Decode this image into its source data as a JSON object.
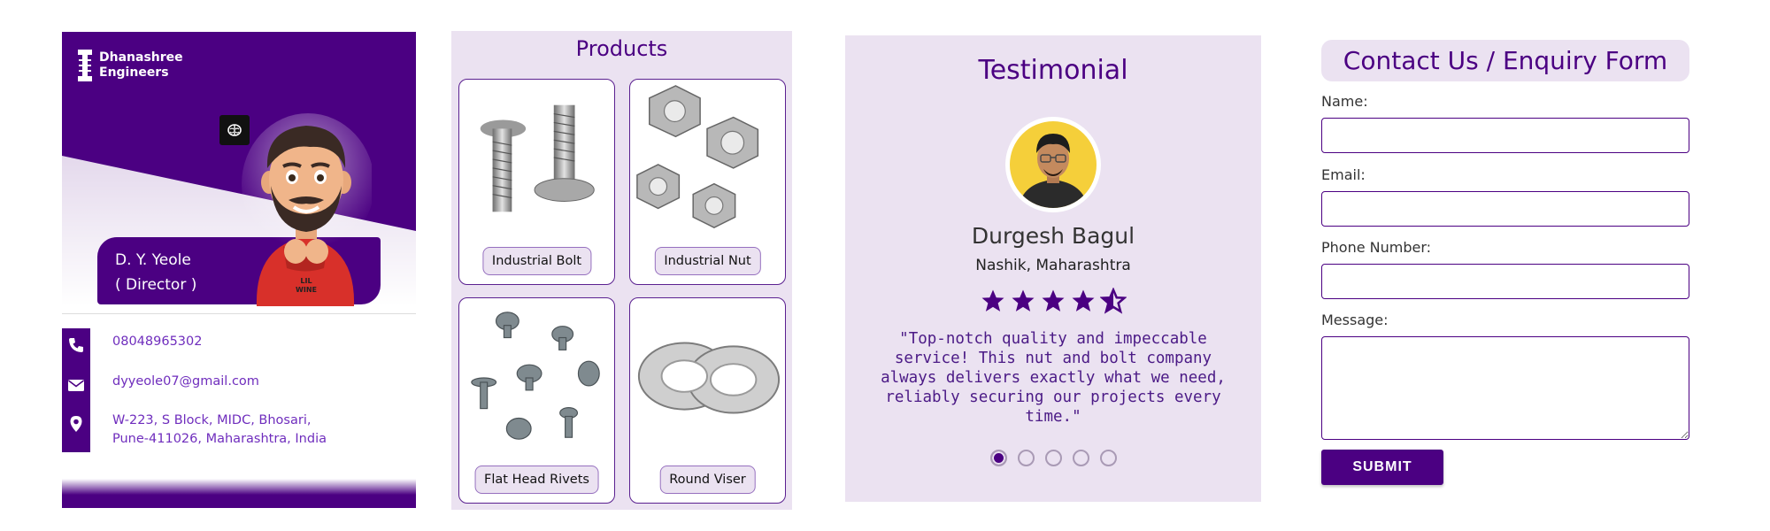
{
  "business_card": {
    "company_line1": "Dhanashree",
    "company_line2": "Engineers",
    "person_name": "D. Y. Yeole",
    "person_title": "( Director )",
    "phone": "08048965302",
    "email": "dyyeole07@gmail.com",
    "address_line1": "W-223, S Block, MIDC, Bhosari,",
    "address_line2": "Pune-411026, Maharashtra, India",
    "icons": [
      "brain-icon",
      "phone-icon",
      "envelope-icon",
      "map-pin-icon"
    ]
  },
  "products": {
    "title": "Products",
    "items": [
      {
        "label": "Industrial Bolt"
      },
      {
        "label": "Industrial Nut"
      },
      {
        "label": "Flat Head Rivets"
      },
      {
        "label": "Round Viser"
      }
    ]
  },
  "testimonial": {
    "title": "Testimonial",
    "name": "Durgesh Bagul",
    "location": "Nashik, Maharashtra",
    "rating": 4.5,
    "rating_max": 5,
    "quote": "\"Top-notch quality and impeccable service! This nut and bolt company always delivers exactly what we need, reliably securing our projects every time.\"",
    "slides_total": 5,
    "active_slide": 1
  },
  "form": {
    "title": "Contact Us / Enquiry Form",
    "name_label": "Name:",
    "email_label": "Email:",
    "phone_label": "Phone Number:",
    "message_label": "Message:",
    "name_value": "",
    "email_value": "",
    "phone_value": "",
    "message_value": "",
    "submit_label": "SUBMIT"
  },
  "colors": {
    "brand_purple": "#4b0082",
    "light_lavender": "#ebe2f1",
    "link_purple": "#6f2dbd"
  }
}
